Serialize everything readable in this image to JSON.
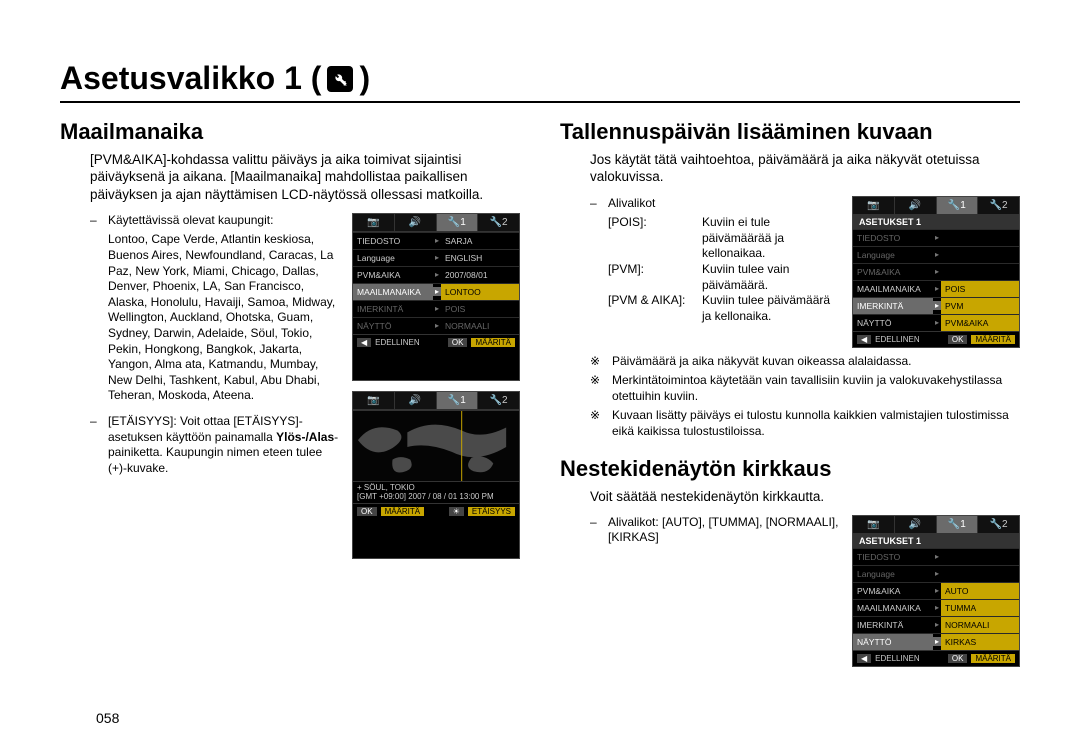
{
  "page_title_prefix": "Asetusvalikko 1 (",
  "page_title_suffix": ")",
  "page_number": "058",
  "left": {
    "heading": "Maailmanaika",
    "intro": "[PVM&AIKA]-kohdassa valittu päiväys ja aika toimivat sijaintisi päiväyksenä ja aikana. [Maailmanaika] mahdollistaa paikallisen päiväyksen ja ajan näyttämisen LCD-näytössä ollessasi matkoilla.",
    "cities_label": "Käytettävissä olevat kaupungit:",
    "cities": "Lontoo, Cape Verde, Atlantin keskiosa, Buenos Aires, Newfoundland, Caracas, La Paz, New York, Miami, Chicago, Dallas, Denver, Phoenix, LA, San Francisco, Alaska, Honolulu, Havaiji, Samoa, Midway, Wellington, Auckland, Ohotska, Guam, Sydney, Darwin, Adelaide, Söul, Tokio, Pekin, Hongkong, Bangkok, Jakarta, Yangon, Alma ata, Katmandu, Mumbay, New Delhi, Tashkent, Kabul, Abu Dhabi, Teheran, Moskoda, Ateena.",
    "dst_label": "[ETÄISYYS]: ",
    "dst_text_1": "Voit ottaa [ETÄISYYS]-asetuksen käyttöön painamalla ",
    "dst_bold": "Ylös-/Alas",
    "dst_text_2": "-painiketta. Kaupungin nimen eteen tulee (+)-kuvake.",
    "lcd1": {
      "tabs": [
        "📷",
        "🔊",
        "🔧1",
        "🔧2"
      ],
      "active_tab_index": 2,
      "rows": [
        {
          "left": "TIEDOSTO",
          "right": "SARJA",
          "hl": false
        },
        {
          "left": "Language",
          "right": "ENGLISH",
          "hl": false
        },
        {
          "left": "PVM&AIKA",
          "right": "2007/08/01",
          "hl": false
        },
        {
          "left": "MAAILMANAIKA",
          "right": "LONTOO",
          "hl": true,
          "hlr": true
        },
        {
          "left": "IMERKINTÄ",
          "right": "POIS",
          "hl": false,
          "dim": true
        },
        {
          "left": "NÄYTTÖ",
          "right": "NORMAALI",
          "hl": false,
          "dim": true
        }
      ],
      "footer_left_key": "◀",
      "footer_left_label": "EDELLINEN",
      "footer_right_key": "OK",
      "footer_right_label": "MÄÄRITÄ"
    },
    "lcd2": {
      "tabs": [
        "📷",
        "🔊",
        "🔧1",
        "🔧2"
      ],
      "active_tab_index": 2,
      "city_line": "+ SÖUL, TOKIO",
      "gmt_line": "[GMT +09:00] 2007 / 08 / 01  13:00 PM",
      "footer_left_key": "OK",
      "footer_left_label": "MÄÄRITÄ",
      "footer_right_key": "☀",
      "footer_right_label": "ETÄISYYS"
    }
  },
  "right_top": {
    "heading": "Tallennuspäivän lisääminen kuvaan",
    "intro": "Jos käytät tätä vaihtoehtoa, päivämäärä ja aika näkyvät otetuissa valokuvissa.",
    "sub_label": "Alivalikot",
    "defs": [
      {
        "term": "[POIS]:",
        "desc": "Kuviin ei tule päivämäärää ja kellonaikaa."
      },
      {
        "term": "[PVM]:",
        "desc": "Kuviin tulee vain päivämäärä."
      },
      {
        "term": "[PVM & AIKA]:",
        "desc": "Kuviin tulee päivämäärä ja kellonaika."
      }
    ],
    "notes": [
      "Päivämäärä ja aika näkyvät kuvan oikeassa alalaidassa.",
      "Merkintätoimintoa käytetään vain tavallisiin kuviin ja valokuvakehystilassa otettuihin kuviin.",
      "Kuvaan lisätty päiväys ei tulostu kunnolla kaikkien valmistajien tulostimissa eikä kaikissa tulostustiloissa."
    ],
    "lcd": {
      "tabs": [
        "📷",
        "🔊",
        "🔧1",
        "🔧2"
      ],
      "active_tab_index": 2,
      "header": "ASETUKSET 1",
      "rows": [
        {
          "left": "TIEDOSTO",
          "right": "",
          "dim": true
        },
        {
          "left": "Language",
          "right": "",
          "dim": true
        },
        {
          "left": "PVM&AIKA",
          "right": "",
          "dim": true
        },
        {
          "left": "MAAILMANAIKA",
          "right": "POIS",
          "hl": false,
          "opt": true
        },
        {
          "left": "IMERKINTÄ",
          "right": "PVM",
          "hl": true,
          "opt": true
        },
        {
          "left": "NÄYTTÖ",
          "right": "PVM&AIKA",
          "opt": true
        }
      ],
      "footer_left_key": "◀",
      "footer_left_label": "EDELLINEN",
      "footer_right_key": "OK",
      "footer_right_label": "MÄÄRITÄ"
    }
  },
  "right_bottom": {
    "heading": "Nestekidenäytön kirkkaus",
    "intro": "Voit säätää nestekidenäytön kirkkautta.",
    "sub_label": "Alivalikot: [AUTO], [TUMMA], [NORMAALI], [KIRKAS]",
    "lcd": {
      "tabs": [
        "📷",
        "🔊",
        "🔧1",
        "🔧2"
      ],
      "active_tab_index": 2,
      "header": "ASETUKSET 1",
      "rows": [
        {
          "left": "TIEDOSTO",
          "right": "",
          "dim": true
        },
        {
          "left": "Language",
          "right": "",
          "dim": true
        },
        {
          "left": "PVM&AIKA",
          "right": "AUTO",
          "opt": true
        },
        {
          "left": "MAAILMANAIKA",
          "right": "TUMMA",
          "opt": true
        },
        {
          "left": "IMERKINTÄ",
          "right": "NORMAALI",
          "opt": true
        },
        {
          "left": "NÄYTTÖ",
          "right": "KIRKAS",
          "hl": true,
          "opt": true
        }
      ],
      "footer_left_key": "◀",
      "footer_left_label": "EDELLINEN",
      "footer_right_key": "OK",
      "footer_right_label": "MÄÄRITÄ"
    }
  }
}
